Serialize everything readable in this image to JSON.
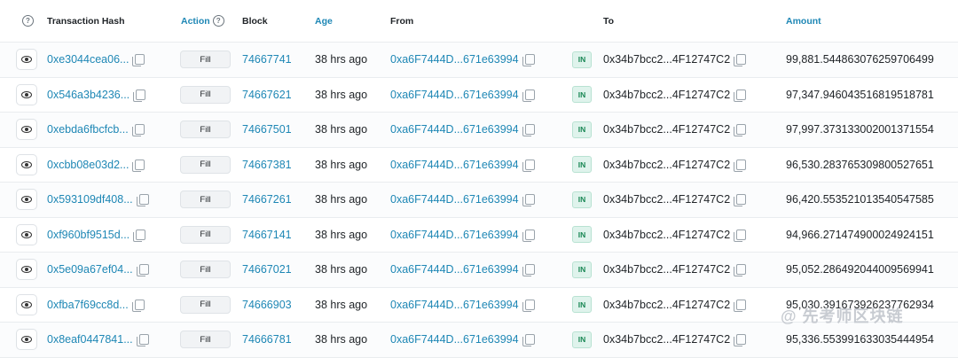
{
  "header": {
    "help_glyph": "?",
    "tx_hash": "Transaction Hash",
    "action": "Action",
    "action_help_glyph": "?",
    "block": "Block",
    "age": "Age",
    "from": "From",
    "to": "To",
    "amount": "Amount"
  },
  "rows": [
    {
      "hash": "0xe3044cea06...",
      "action": "Fill",
      "block": "74667741",
      "age": "38 hrs ago",
      "from": "0xa6F7444D...671e63994",
      "dir": "IN",
      "to": "0x34b7bcc2...4F12747C2",
      "amount": "99,881.544863076259706499"
    },
    {
      "hash": "0x546a3b4236...",
      "action": "Fill",
      "block": "74667621",
      "age": "38 hrs ago",
      "from": "0xa6F7444D...671e63994",
      "dir": "IN",
      "to": "0x34b7bcc2...4F12747C2",
      "amount": "97,347.946043516819518781"
    },
    {
      "hash": "0xebda6fbcfcb...",
      "action": "Fill",
      "block": "74667501",
      "age": "38 hrs ago",
      "from": "0xa6F7444D...671e63994",
      "dir": "IN",
      "to": "0x34b7bcc2...4F12747C2",
      "amount": "97,997.373133002001371554"
    },
    {
      "hash": "0xcbb08e03d2...",
      "action": "Fill",
      "block": "74667381",
      "age": "38 hrs ago",
      "from": "0xa6F7444D...671e63994",
      "dir": "IN",
      "to": "0x34b7bcc2...4F12747C2",
      "amount": "96,530.283765309800527651"
    },
    {
      "hash": "0x593109df408...",
      "action": "Fill",
      "block": "74667261",
      "age": "38 hrs ago",
      "from": "0xa6F7444D...671e63994",
      "dir": "IN",
      "to": "0x34b7bcc2...4F12747C2",
      "amount": "96,420.553521013540547585"
    },
    {
      "hash": "0xf960bf9515d...",
      "action": "Fill",
      "block": "74667141",
      "age": "38 hrs ago",
      "from": "0xa6F7444D...671e63994",
      "dir": "IN",
      "to": "0x34b7bcc2...4F12747C2",
      "amount": "94,966.271474900024924151"
    },
    {
      "hash": "0x5e09a67ef04...",
      "action": "Fill",
      "block": "74667021",
      "age": "38 hrs ago",
      "from": "0xa6F7444D...671e63994",
      "dir": "IN",
      "to": "0x34b7bcc2...4F12747C2",
      "amount": "95,052.286492044009569941"
    },
    {
      "hash": "0xfba7f69cc8d...",
      "action": "Fill",
      "block": "74666903",
      "age": "38 hrs ago",
      "from": "0xa6F7444D...671e63994",
      "dir": "IN",
      "to": "0x34b7bcc2...4F12747C2",
      "amount": "95,030.391673926237762934"
    },
    {
      "hash": "0x8eaf0447841...",
      "action": "Fill",
      "block": "74666781",
      "age": "38 hrs ago",
      "from": "0xa6F7444D...671e63994",
      "dir": "IN",
      "to": "0x34b7bcc2...4F12747C2",
      "amount": "95,336.553991633035444954"
    }
  ],
  "watermark": "@ 先考师区块链",
  "colors": {
    "link": "#1e87b5",
    "in_badge_bg": "#dff3ec",
    "in_badge_text": "#198754"
  }
}
